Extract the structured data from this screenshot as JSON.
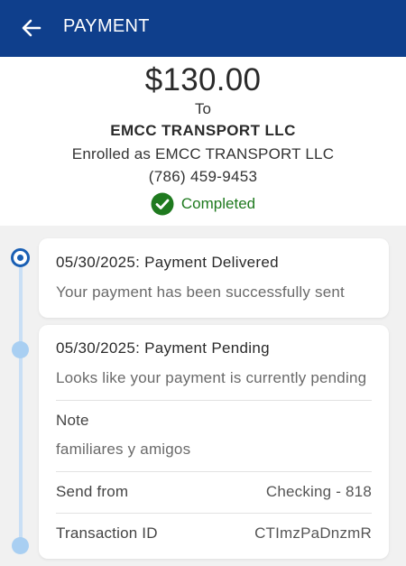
{
  "header": {
    "title": "PAYMENT",
    "back_icon": "arrow-left-icon",
    "background": "#0f3f8c"
  },
  "summary": {
    "amount": "$130.00",
    "to_label": "To",
    "payee": "EMCC TRANSPORT LLC",
    "enrolled": "Enrolled as EMCC TRANSPORT LLC",
    "phone": "(786) 459-9453",
    "status": "Completed",
    "status_icon": "check-circle-icon",
    "status_color": "#1f7a1f"
  },
  "timeline": {
    "events": [
      {
        "title": "05/30/2025: Payment Delivered",
        "description": "Your payment has been successfully sent"
      },
      {
        "title": "05/30/2025: Payment Pending",
        "description": "Looks like your payment is currently pending"
      }
    ],
    "details": {
      "note_label": "Note",
      "note_value": "familiares y amigos",
      "send_from_label": "Send from",
      "send_from_value": "Checking - 818",
      "transaction_id_label": "Transaction ID",
      "transaction_id_value": "CTImzPaDnzmR"
    }
  }
}
